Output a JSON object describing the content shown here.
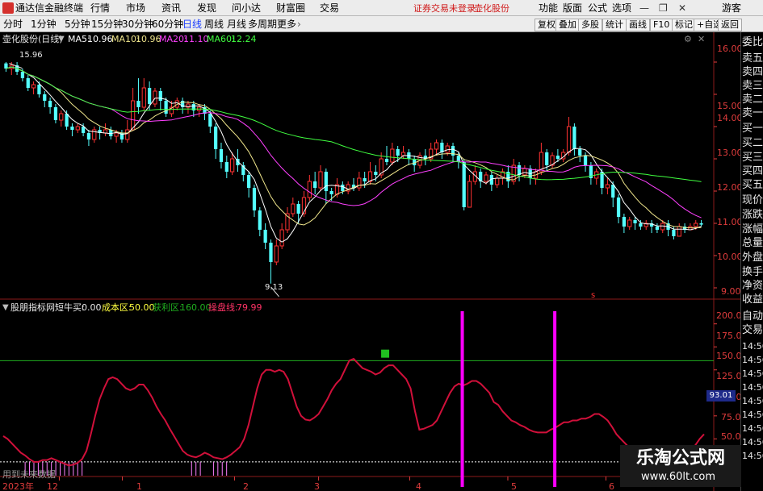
{
  "window": {
    "app_title": "通达信金融终端",
    "menu": [
      "行情",
      "市场",
      "资讯",
      "发现",
      "问小达",
      "财富圈",
      "交易"
    ],
    "notice": "证券交易未登录",
    "stock_name": "壶化股份",
    "right_menu": [
      "功能",
      "版面",
      "公式",
      "选项"
    ],
    "guest": "游客"
  },
  "toolbar": {
    "periods": [
      "分时",
      "1分钟",
      "5分钟",
      "15分钟",
      "30分钟",
      "60分钟",
      "日线",
      "周线",
      "月线",
      "多周期",
      "更多"
    ],
    "active_period": "日线",
    "actions": [
      "复权",
      "叠加",
      "多股",
      "统计",
      "画线",
      "F10",
      "标记",
      "+自选",
      "返回"
    ]
  },
  "main_panel": {
    "stock_label": "壶化股份(日线)",
    "ma": [
      {
        "name": "MA5:",
        "value": "10.96",
        "color": "#ffffff"
      },
      {
        "name": "MA10:",
        "value": "10.96",
        "color": "#f0e68c"
      },
      {
        "name": "MA20:",
        "value": "11.10",
        "color": "#ff40ff"
      },
      {
        "name": "MA60:",
        "value": "12.24",
        "color": "#40ff40"
      }
    ],
    "high_label": "15.96",
    "low_label": "9.13",
    "marker_s": "s"
  },
  "indicator": {
    "name": "股朋指标网",
    "items": [
      {
        "name": "短牛买:",
        "value": "0.00",
        "color": "#e8e8e8"
      },
      {
        "name": "成本区:",
        "value": "50.00",
        "color": "#ffff40"
      },
      {
        "name": "获利区:",
        "value": "160.00",
        "color": "#20b020"
      },
      {
        "name": "操盘线:",
        "value": "79.99",
        "color": "#ff3366"
      }
    ],
    "cursor_value": "93.01",
    "footer": "用到未来数据"
  },
  "axes": {
    "price_ticks": [
      "16.00",
      "15.00",
      "14.00",
      "13.00",
      "12.00",
      "11.00",
      "10.00",
      "9.00"
    ],
    "ind_ticks": [
      "200.0",
      "175.0",
      "150.0",
      "125.0",
      "100.0",
      "75.0",
      "50.0"
    ],
    "dates": [
      "2023年",
      "12",
      "1",
      "2",
      "3",
      "4",
      "5",
      "6"
    ]
  },
  "side_panel": {
    "order_labels": [
      "委比",
      "卖五",
      "卖四",
      "卖三",
      "卖二",
      "卖一",
      "买一",
      "买二",
      "买三",
      "买四",
      "买五"
    ],
    "stat_labels": [
      "现价",
      "涨跌",
      "涨幅",
      "总量",
      "外盘",
      "换手",
      "净资",
      "收益"
    ],
    "trade_labels": [
      "自动",
      "交易"
    ],
    "tick_times": [
      "14:56",
      "14:56",
      "14:56",
      "14:56",
      "14:56",
      "14:56",
      "14:56",
      "14:56",
      "14:56"
    ]
  },
  "watermark": {
    "brand": "乐淘公式网",
    "url": "www.60lt.com"
  },
  "colors": {
    "up": "#ff3232",
    "down": "#54ffff",
    "bg": "#000000",
    "axis": "#e03c3c"
  },
  "chart_data": {
    "type": "candlestick",
    "series": [
      {
        "name": "MA5",
        "values": []
      },
      {
        "name": "MA10",
        "values": []
      },
      {
        "name": "MA20",
        "values": []
      },
      {
        "name": "MA60",
        "values": []
      }
    ],
    "y_range": [
      8.7,
      16.3
    ],
    "indicator_range": [
      35,
      212
    ],
    "price_levels": [
      16,
      15,
      14,
      13,
      12,
      11,
      10,
      9
    ],
    "indicator_levels": [
      200,
      175,
      150,
      125,
      100,
      75,
      50
    ],
    "reference_lines": {
      "green": 160,
      "dotted": 50
    },
    "candles": [
      [
        15.96,
        15.8,
        16.0,
        15.7
      ],
      [
        15.8,
        15.9,
        16.0,
        15.6
      ],
      [
        15.9,
        15.7,
        16.0,
        15.6
      ],
      [
        15.7,
        15.5,
        15.8,
        15.4
      ],
      [
        15.5,
        15.2,
        15.6,
        15.1
      ],
      [
        15.2,
        15.3,
        15.4,
        15.0
      ],
      [
        15.3,
        15.0,
        15.4,
        14.9
      ],
      [
        15.0,
        14.8,
        15.1,
        14.6
      ],
      [
        14.8,
        14.6,
        14.9,
        14.4
      ],
      [
        14.6,
        14.2,
        14.7,
        14.1
      ],
      [
        14.2,
        14.4,
        14.5,
        14.0
      ],
      [
        14.4,
        14.0,
        14.5,
        13.9
      ],
      [
        14.0,
        13.9,
        14.1,
        13.7
      ],
      [
        13.9,
        14.0,
        14.1,
        13.8
      ],
      [
        14.0,
        13.8,
        14.1,
        13.7
      ],
      [
        13.8,
        13.6,
        13.9,
        13.4
      ],
      [
        13.6,
        13.9,
        14.0,
        13.5
      ],
      [
        13.9,
        13.8,
        14.0,
        13.6
      ],
      [
        13.8,
        13.9,
        14.1,
        13.7
      ],
      [
        13.9,
        13.7,
        14.0,
        13.6
      ],
      [
        13.7,
        13.8,
        13.9,
        13.5
      ],
      [
        13.8,
        13.6,
        13.9,
        13.5
      ],
      [
        13.6,
        13.9,
        14.2,
        13.5
      ],
      [
        13.9,
        14.8,
        15.2,
        13.9
      ],
      [
        14.8,
        14.6,
        15.5,
        14.4
      ],
      [
        14.6,
        15.2,
        15.5,
        14.5
      ],
      [
        15.2,
        14.7,
        15.4,
        14.5
      ],
      [
        14.7,
        15.1,
        15.2,
        14.6
      ],
      [
        15.1,
        14.8,
        15.2,
        14.5
      ],
      [
        14.8,
        14.4,
        14.9,
        14.3
      ],
      [
        14.4,
        14.6,
        14.8,
        14.3
      ],
      [
        14.6,
        14.8,
        14.9,
        14.5
      ],
      [
        14.8,
        14.6,
        14.9,
        14.4
      ],
      [
        14.6,
        14.7,
        14.8,
        14.4
      ],
      [
        14.7,
        14.5,
        14.8,
        14.3
      ],
      [
        14.5,
        14.6,
        14.7,
        14.3
      ],
      [
        14.6,
        14.4,
        14.7,
        14.2
      ],
      [
        14.4,
        14.0,
        14.5,
        13.8
      ],
      [
        14.0,
        13.3,
        14.1,
        13.0
      ],
      [
        13.3,
        12.9,
        13.5,
        12.7
      ],
      [
        12.9,
        12.6,
        13.1,
        12.4
      ],
      [
        12.6,
        13.0,
        13.2,
        12.5
      ],
      [
        13.0,
        12.8,
        13.3,
        12.6
      ],
      [
        12.8,
        12.5,
        12.9,
        12.3
      ],
      [
        12.5,
        12.1,
        12.6,
        11.8
      ],
      [
        12.1,
        11.4,
        12.2,
        11.2
      ],
      [
        11.4,
        10.8,
        11.5,
        10.6
      ],
      [
        10.8,
        10.4,
        11.0,
        10.2
      ],
      [
        10.4,
        9.8,
        10.5,
        9.13
      ],
      [
        9.8,
        10.3,
        10.5,
        9.7
      ],
      [
        10.3,
        10.8,
        11.0,
        10.2
      ],
      [
        10.8,
        11.3,
        11.5,
        10.7
      ],
      [
        11.3,
        11.6,
        11.8,
        11.2
      ],
      [
        11.6,
        11.3,
        11.7,
        11.0
      ],
      [
        11.3,
        11.8,
        12.0,
        11.2
      ],
      [
        11.8,
        12.3,
        12.5,
        11.7
      ],
      [
        12.3,
        12.1,
        12.6,
        11.9
      ],
      [
        12.1,
        12.6,
        12.8,
        12.0
      ],
      [
        12.6,
        12.0,
        12.7,
        11.6
      ],
      [
        12.0,
        11.9,
        12.1,
        11.7
      ],
      [
        11.9,
        12.2,
        12.4,
        11.8
      ],
      [
        12.2,
        12.0,
        12.3,
        11.9
      ],
      [
        12.0,
        12.2,
        12.3,
        11.9
      ],
      [
        12.2,
        12.1,
        12.4,
        12.0
      ],
      [
        12.1,
        12.4,
        12.6,
        12.0
      ],
      [
        12.4,
        12.3,
        12.6,
        12.1
      ],
      [
        12.3,
        12.6,
        12.9,
        12.2
      ],
      [
        12.6,
        12.5,
        12.8,
        12.3
      ],
      [
        12.5,
        13.0,
        13.2,
        12.4
      ],
      [
        13.0,
        12.9,
        13.4,
        12.8
      ],
      [
        12.9,
        13.3,
        13.5,
        12.8
      ],
      [
        13.3,
        13.1,
        13.4,
        12.9
      ],
      [
        13.1,
        13.2,
        13.4,
        13.0
      ],
      [
        13.2,
        13.0,
        13.3,
        12.8
      ],
      [
        13.0,
        12.8,
        13.1,
        12.6
      ],
      [
        12.8,
        13.1,
        13.2,
        12.7
      ],
      [
        13.1,
        13.0,
        13.3,
        12.8
      ],
      [
        13.0,
        13.3,
        13.5,
        12.9
      ],
      [
        13.3,
        13.5,
        13.6,
        13.1
      ],
      [
        13.5,
        13.2,
        13.6,
        13.0
      ],
      [
        13.2,
        13.4,
        13.5,
        13.1
      ],
      [
        13.4,
        13.1,
        13.5,
        12.9
      ],
      [
        13.1,
        12.9,
        13.2,
        12.7
      ],
      [
        12.9,
        11.5,
        13.0,
        11.4
      ],
      [
        11.5,
        12.3,
        12.5,
        11.6
      ],
      [
        12.3,
        12.6,
        12.8,
        12.2
      ],
      [
        12.6,
        12.3,
        12.7,
        12.1
      ],
      [
        12.3,
        12.5,
        12.6,
        12.2
      ],
      [
        12.5,
        12.2,
        12.6,
        12.0
      ],
      [
        12.2,
        12.4,
        12.5,
        12.1
      ],
      [
        12.4,
        12.6,
        12.7,
        12.2
      ],
      [
        12.6,
        12.3,
        12.8,
        12.1
      ],
      [
        12.3,
        12.8,
        13.0,
        12.2
      ],
      [
        12.8,
        12.5,
        12.9,
        12.3
      ],
      [
        12.5,
        12.7,
        12.8,
        12.4
      ],
      [
        12.7,
        12.4,
        12.8,
        12.2
      ],
      [
        12.4,
        12.6,
        12.7,
        12.2
      ],
      [
        12.6,
        13.2,
        13.5,
        12.5
      ],
      [
        13.2,
        12.8,
        13.3,
        12.6
      ],
      [
        12.8,
        13.1,
        13.2,
        12.7
      ],
      [
        13.1,
        13.0,
        13.3,
        12.9
      ],
      [
        13.0,
        13.2,
        13.3,
        12.9
      ],
      [
        13.2,
        14.0,
        14.3,
        13.1
      ],
      [
        14.0,
        13.3,
        14.1,
        13.1
      ],
      [
        13.3,
        13.1,
        13.4,
        12.9
      ],
      [
        13.1,
        12.8,
        13.2,
        12.6
      ],
      [
        12.8,
        12.4,
        12.9,
        12.2
      ],
      [
        12.4,
        12.6,
        12.7,
        12.2
      ],
      [
        12.6,
        12.1,
        12.7,
        11.9
      ],
      [
        12.1,
        12.2,
        12.4,
        11.9
      ],
      [
        12.2,
        11.8,
        12.3,
        11.5
      ],
      [
        11.8,
        11.2,
        11.9,
        11.0
      ],
      [
        11.2,
        10.9,
        11.3,
        10.7
      ],
      [
        10.9,
        11.1,
        11.2,
        10.8
      ],
      [
        11.1,
        11.0,
        11.2,
        10.8
      ],
      [
        11.0,
        10.9,
        11.1,
        10.8
      ],
      [
        10.9,
        11.0,
        11.1,
        10.8
      ],
      [
        11.0,
        10.9,
        11.1,
        10.7
      ],
      [
        10.9,
        10.8,
        11.0,
        10.7
      ],
      [
        10.8,
        11.0,
        11.1,
        10.7
      ],
      [
        11.0,
        10.8,
        11.1,
        10.6
      ],
      [
        10.8,
        10.6,
        10.9,
        10.5
      ],
      [
        10.6,
        10.9,
        11.0,
        10.6
      ],
      [
        10.9,
        10.8,
        11.0,
        10.7
      ],
      [
        10.8,
        10.9,
        11.0,
        10.8
      ],
      [
        10.9,
        11.0,
        11.1,
        10.8
      ],
      [
        11.0,
        10.96,
        11.1,
        10.9
      ]
    ],
    "operation_line": [
      78,
      75,
      70,
      65,
      60,
      57,
      53,
      50,
      50,
      52,
      52,
      54,
      52,
      50,
      48,
      46,
      47,
      49,
      53,
      62,
      80,
      100,
      118,
      130,
      140,
      142,
      140,
      135,
      130,
      128,
      130,
      134,
      134,
      128,
      120,
      110,
      102,
      95,
      86,
      78,
      70,
      62,
      58,
      56,
      55,
      57,
      60,
      58,
      55,
      54,
      53,
      55,
      58,
      62,
      66,
      75,
      90,
      110,
      130,
      145,
      150,
      150,
      148,
      150,
      148,
      140,
      125,
      110,
      100,
      96,
      95,
      98,
      102,
      110,
      118,
      128,
      135,
      140,
      150,
      160,
      162,
      157,
      152,
      150,
      148,
      145,
      147,
      152,
      155,
      155,
      150,
      145,
      140,
      130,
      105,
      85,
      86,
      88,
      90,
      95,
      105,
      115,
      125,
      132,
      135,
      133,
      135,
      138,
      138,
      135,
      130,
      125,
      115,
      112,
      105,
      100,
      95,
      93,
      90,
      88,
      85,
      83,
      82,
      82,
      82,
      85,
      87,
      90,
      93,
      93,
      95,
      95,
      97,
      97,
      99,
      102,
      102,
      99,
      95,
      88,
      80,
      75,
      70,
      65,
      63,
      60,
      55,
      53,
      52,
      52,
      50,
      50,
      50,
      50,
      52,
      55,
      58,
      62,
      68,
      75,
      80
    ],
    "date_marks": [
      0.08,
      0.17,
      0.33,
      0.45,
      0.58,
      0.72,
      0.86
    ]
  }
}
